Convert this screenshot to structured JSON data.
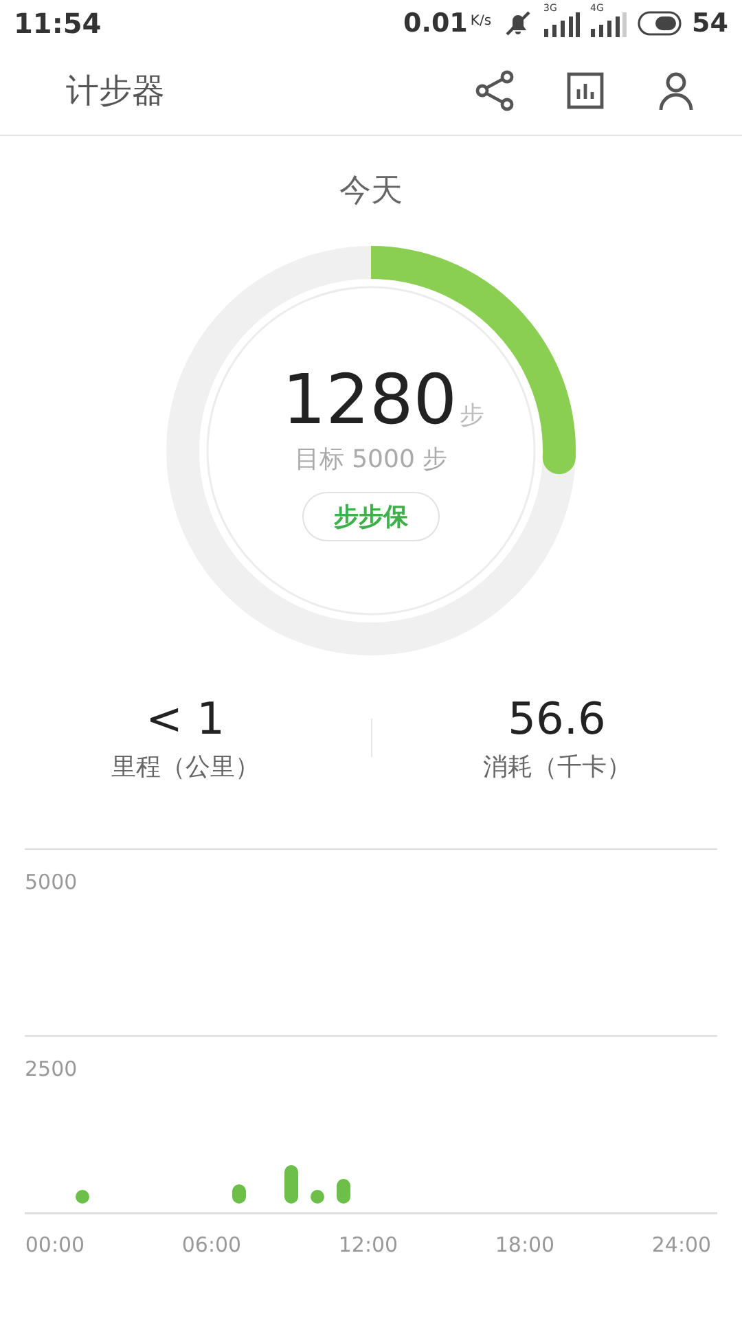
{
  "status_bar": {
    "time": "11:54",
    "speed": "0.01",
    "speed_unit": "K/s",
    "network_1": "3G",
    "network_2": "4G",
    "battery": "54"
  },
  "header": {
    "title": "计步器"
  },
  "today": {
    "label": "今天",
    "steps": "1280",
    "steps_unit": "步",
    "goal": "目标 5000 步",
    "button": "步步保"
  },
  "stats": [
    {
      "value": "< 1",
      "label": "里程（公里）"
    },
    {
      "value": "56.6",
      "label": "消耗（千卡）"
    }
  ],
  "chart": {
    "y_labels": [
      "5000",
      "2500"
    ],
    "x_labels": [
      "00:00",
      "06:00",
      "12:00",
      "18:00",
      "24:00"
    ]
  }
}
